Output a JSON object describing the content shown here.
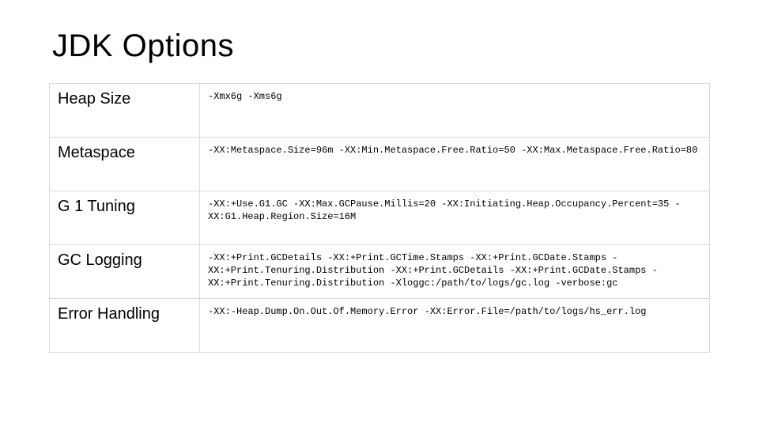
{
  "title": "JDK Options",
  "rows": [
    {
      "label": "Heap Size",
      "value": "-Xmx6g -Xms6g"
    },
    {
      "label": "Metaspace",
      "value": "-XX:Metaspace.Size=96m -XX:Min.Metaspace.Free.Ratio=50 -XX:Max.Metaspace.Free.Ratio=80"
    },
    {
      "label": "G 1 Tuning",
      "value": "-XX:+Use.G1.GC -XX:Max.GCPause.Millis=20 -XX:Initiating.Heap.Occupancy.Percent=35 -XX:G1.Heap.Region.Size=16M"
    },
    {
      "label": "GC Logging",
      "value": "-XX:+Print.GCDetails -XX:+Print.GCTime.Stamps -XX:+Print.GCDate.Stamps -XX:+Print.Tenuring.Distribution -XX:+Print.GCDetails -XX:+Print.GCDate.Stamps -XX:+Print.Tenuring.Distribution -Xloggc:/path/to/logs/gc.log -verbose:gc"
    },
    {
      "label": "Error Handling",
      "value": "-XX:-Heap.Dump.On.Out.Of.Memory.Error -XX:Error.File=/path/to/logs/hs_err.log"
    }
  ]
}
